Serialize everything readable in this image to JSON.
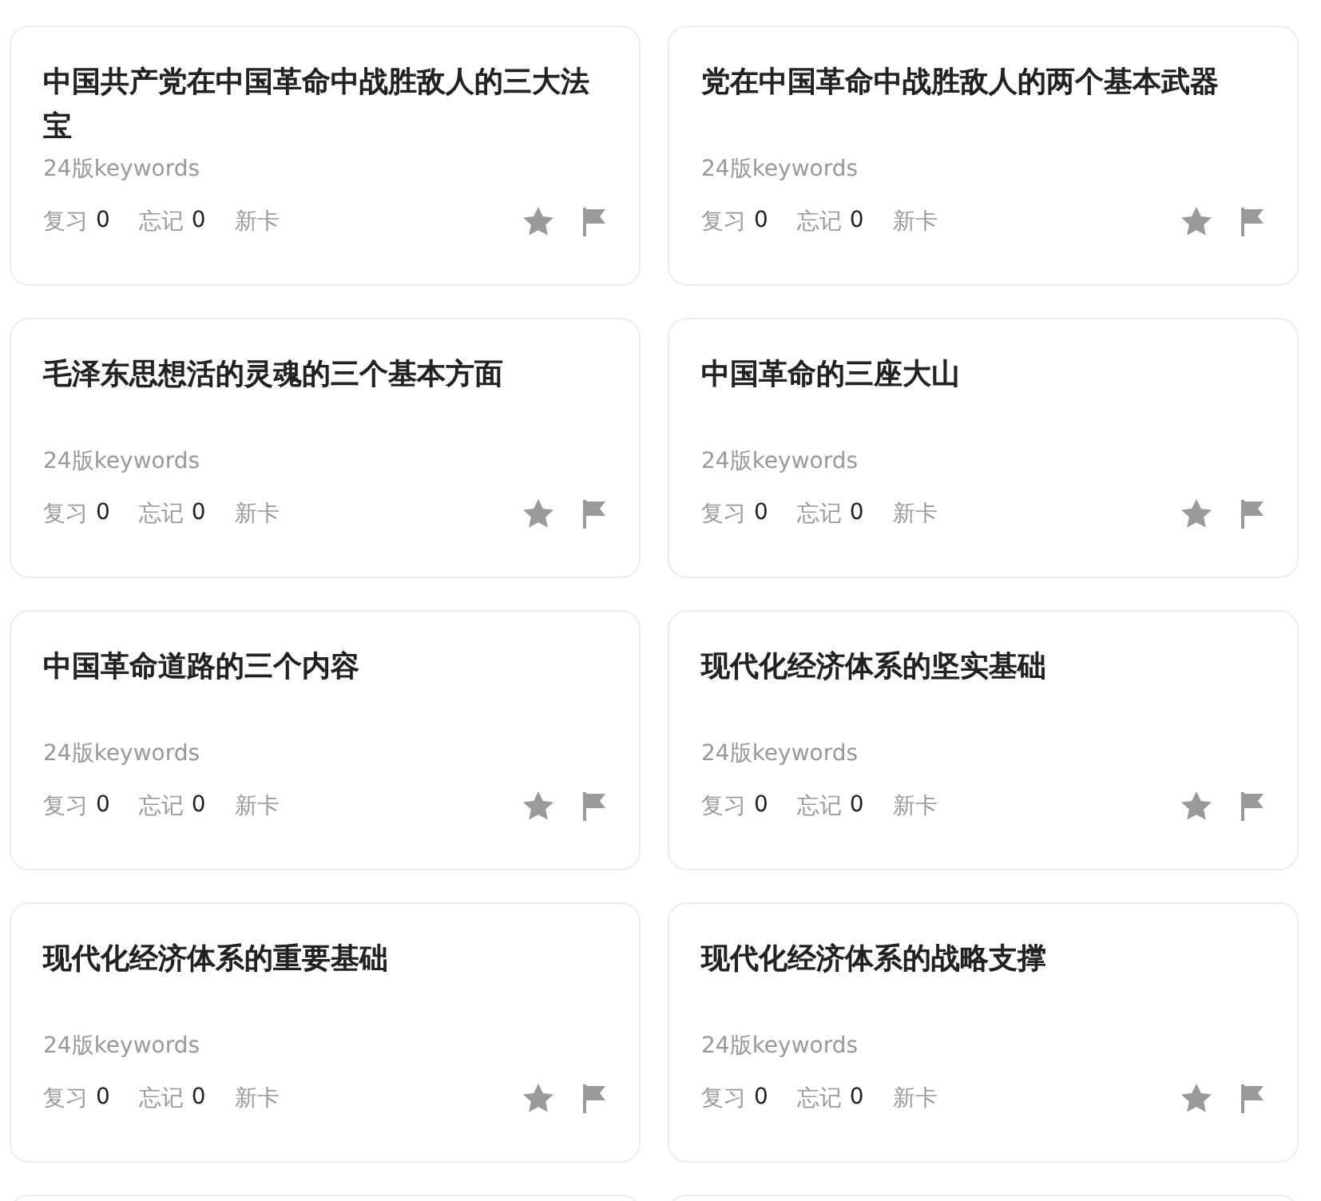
{
  "cards": [
    {
      "title": "中国共产党在中国革命中战胜敌人的三大法宝",
      "source": "24版keywords",
      "stats": [
        {
          "label": "复习",
          "value": "0"
        },
        {
          "label": "忘记",
          "value": "0"
        }
      ],
      "new_label": "新卡"
    },
    {
      "title": "党在中国革命中战胜敌人的两个基本武器",
      "source": "24版keywords",
      "stats": [
        {
          "label": "复习",
          "value": "0"
        },
        {
          "label": "忘记",
          "value": "0"
        }
      ],
      "new_label": "新卡"
    },
    {
      "title": "毛泽东思想活的灵魂的三个基本方面",
      "source": "24版keywords",
      "stats": [
        {
          "label": "复习",
          "value": "0"
        },
        {
          "label": "忘记",
          "value": "0"
        }
      ],
      "new_label": "新卡"
    },
    {
      "title": "中国革命的三座大山",
      "source": "24版keywords",
      "stats": [
        {
          "label": "复习",
          "value": "0"
        },
        {
          "label": "忘记",
          "value": "0"
        }
      ],
      "new_label": "新卡"
    },
    {
      "title": "中国革命道路的三个内容",
      "source": "24版keywords",
      "stats": [
        {
          "label": "复习",
          "value": "0"
        },
        {
          "label": "忘记",
          "value": "0"
        }
      ],
      "new_label": "新卡"
    },
    {
      "title": "现代化经济体系的坚实基础",
      "source": "24版keywords",
      "stats": [
        {
          "label": "复习",
          "value": "0"
        },
        {
          "label": "忘记",
          "value": "0"
        }
      ],
      "new_label": "新卡"
    },
    {
      "title": "现代化经济体系的重要基础",
      "source": "24版keywords",
      "stats": [
        {
          "label": "复习",
          "value": "0"
        },
        {
          "label": "忘记",
          "value": "0"
        }
      ],
      "new_label": "新卡"
    },
    {
      "title": "现代化经济体系的战略支撑",
      "source": "24版keywords",
      "stats": [
        {
          "label": "复习",
          "value": "0"
        },
        {
          "label": "忘记",
          "value": "0"
        }
      ],
      "new_label": "新卡"
    }
  ]
}
